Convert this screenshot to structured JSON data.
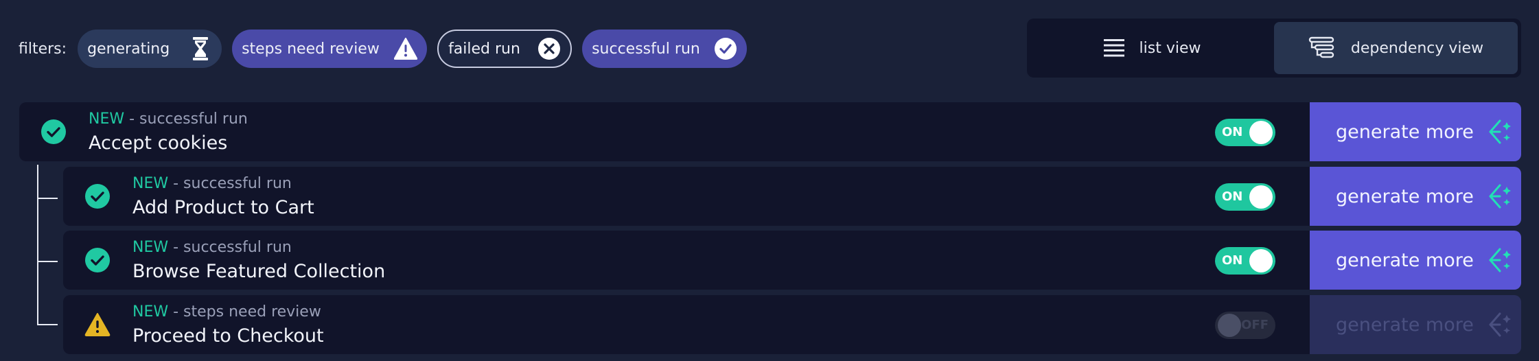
{
  "filters": {
    "label": "filters:",
    "chips": [
      {
        "label": "generating",
        "icon": "hourglass-icon"
      },
      {
        "label": "steps need review",
        "icon": "warning-icon"
      },
      {
        "label": "failed run",
        "icon": "x-circle-icon"
      },
      {
        "label": "successful run",
        "icon": "check-circle-icon"
      }
    ]
  },
  "view_toggle": {
    "list": "list view",
    "dependency": "dependency view",
    "active": "dependency"
  },
  "rows": [
    {
      "badge": "NEW",
      "status": " - successful run",
      "title": "Accept cookies",
      "status_icon": "check-circle-icon",
      "toggle_label": "ON",
      "toggle_on": true,
      "generate_label": "generate more",
      "generate_enabled": true
    },
    {
      "badge": "NEW",
      "status": " - successful run",
      "title": "Add Product to Cart",
      "status_icon": "check-circle-icon",
      "toggle_label": "ON",
      "toggle_on": true,
      "generate_label": "generate more",
      "generate_enabled": true
    },
    {
      "badge": "NEW",
      "status": " - successful run",
      "title": "Browse Featured Collection",
      "status_icon": "check-circle-icon",
      "toggle_label": "ON",
      "toggle_on": true,
      "generate_label": "generate more",
      "generate_enabled": true
    },
    {
      "badge": "NEW",
      "status": " - steps need review",
      "title": "Proceed to Checkout",
      "status_icon": "warning-icon",
      "toggle_label": "OFF",
      "toggle_on": false,
      "generate_label": "generate more",
      "generate_enabled": false
    }
  ],
  "colors": {
    "background": "#1a2138",
    "accent_green": "#20c9a2",
    "accent_purple": "#5a55d6",
    "warning": "#e4b524"
  }
}
